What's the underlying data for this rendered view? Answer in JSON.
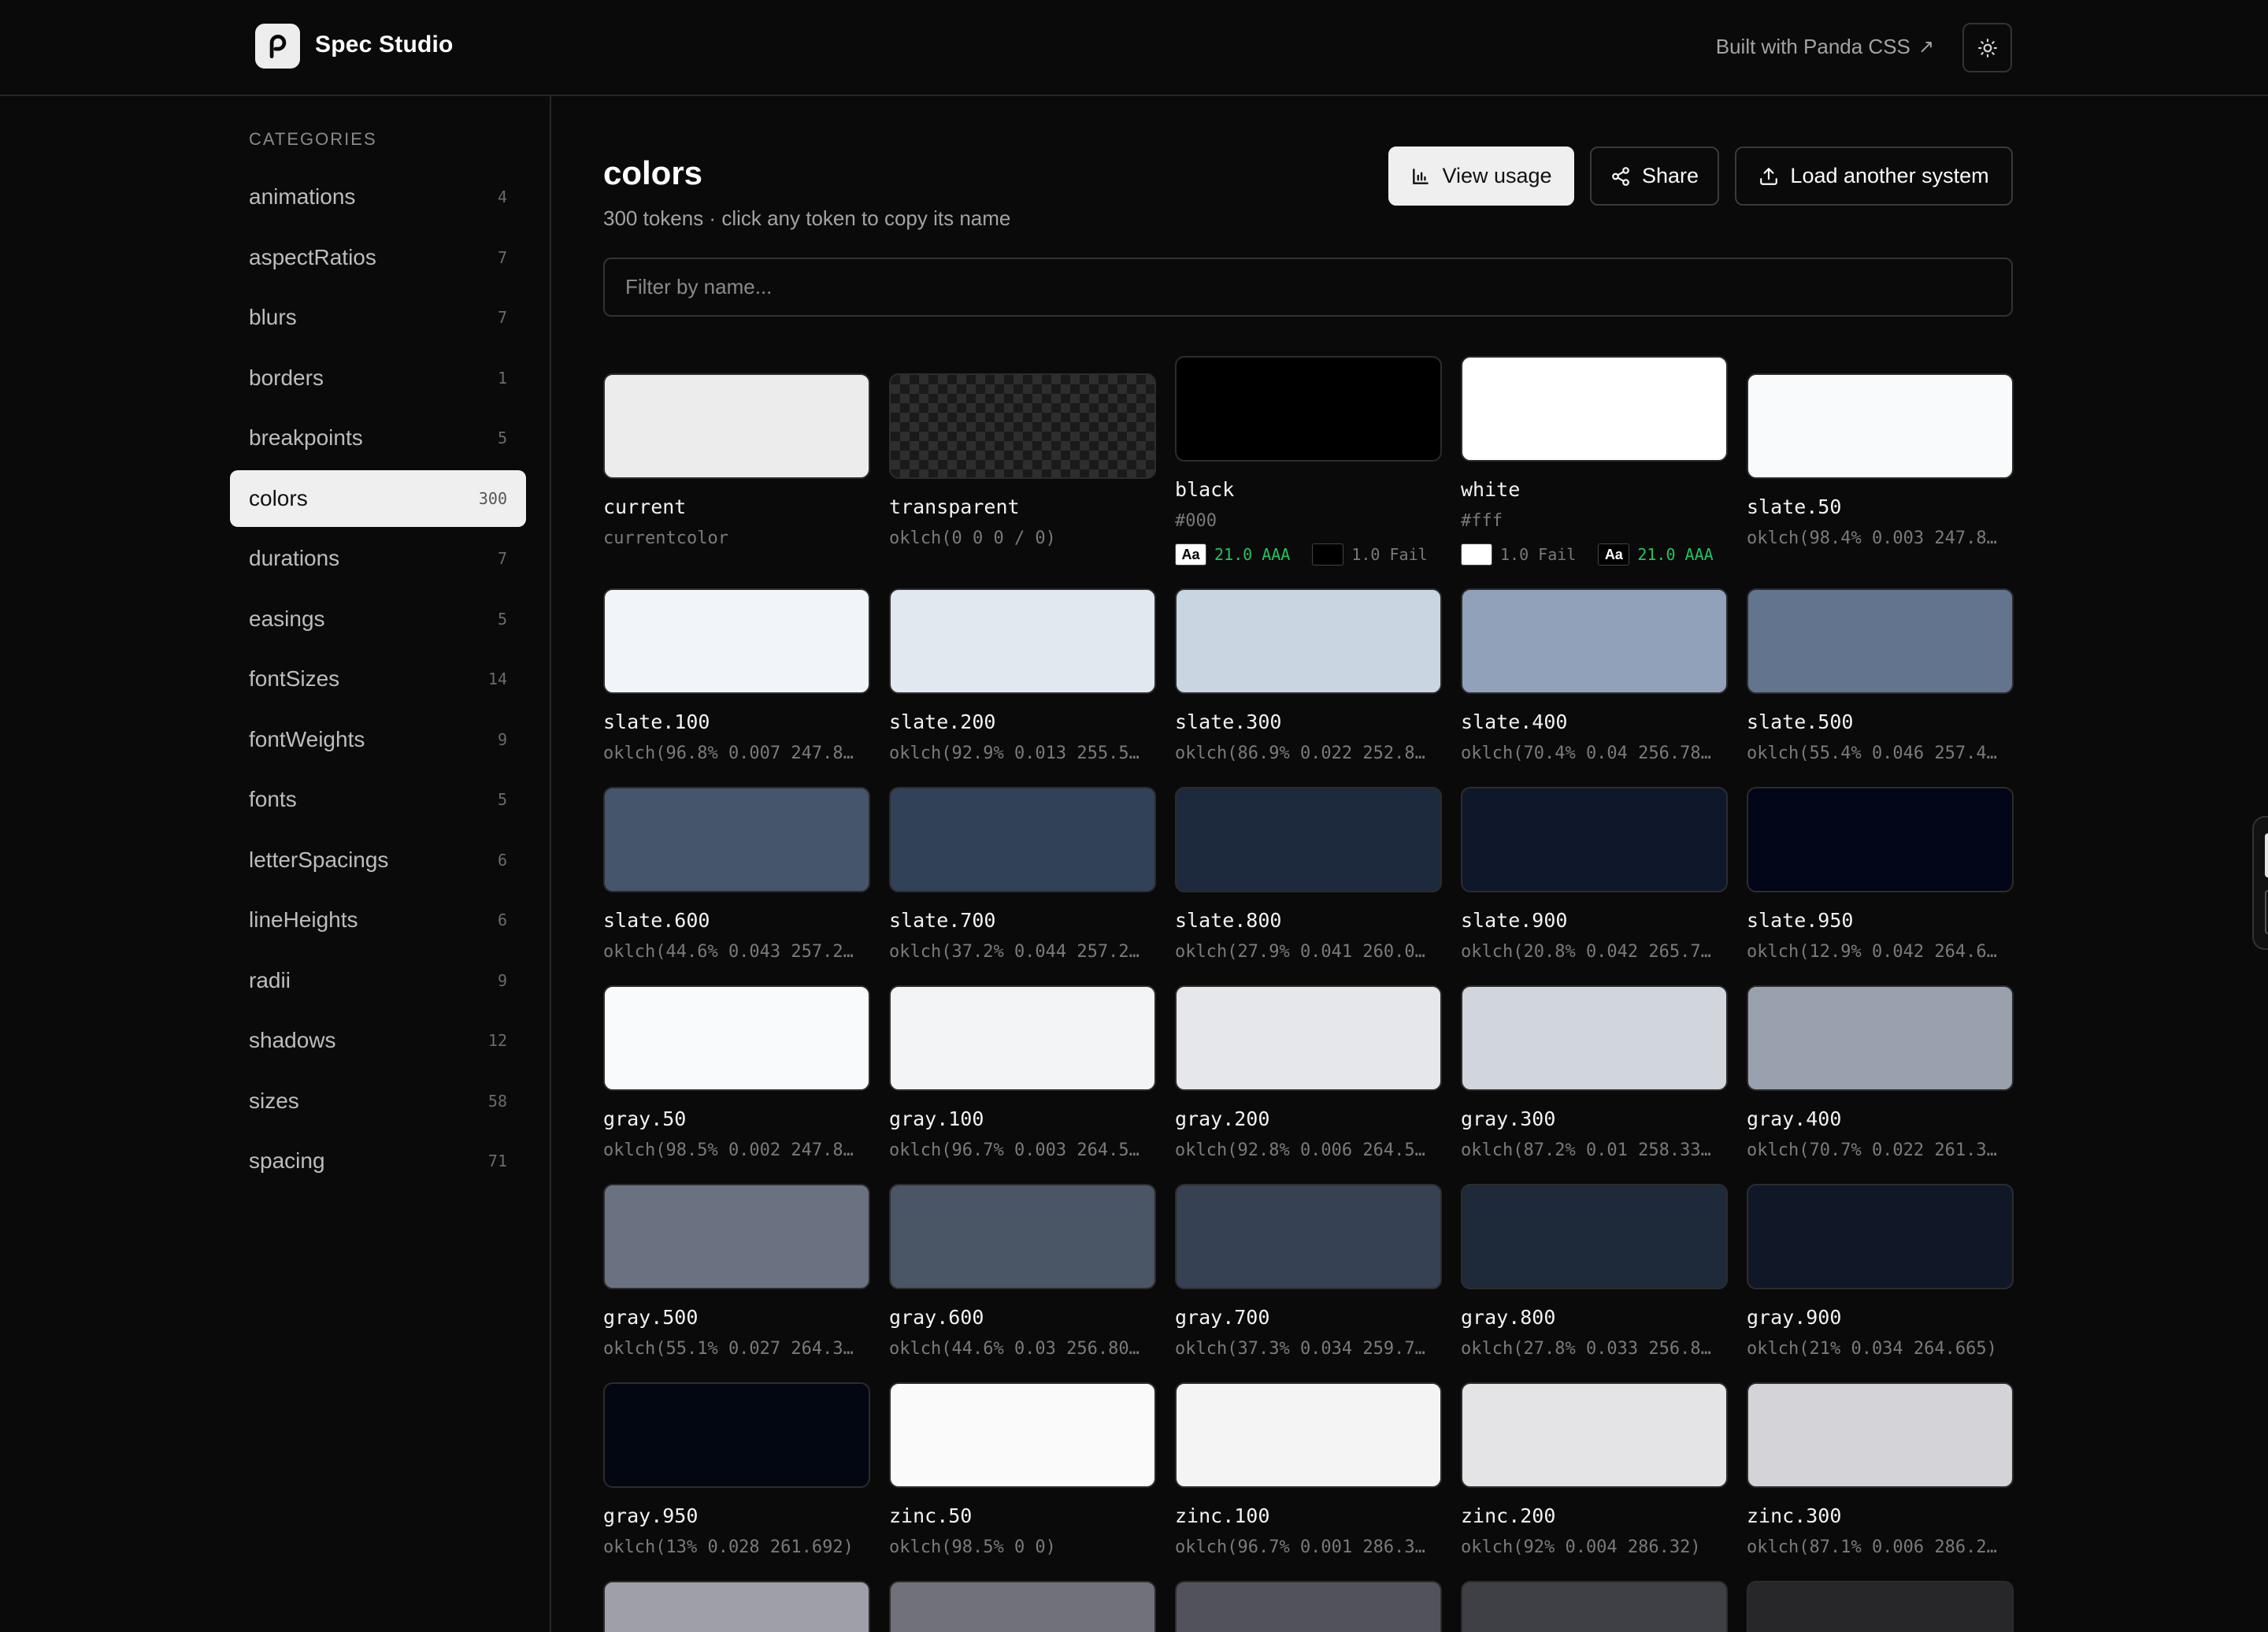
{
  "header": {
    "app_title": "Spec Studio",
    "built_with": "Built with Panda CSS",
    "built_with_icon": "external-link-icon",
    "theme_icon": "sun-icon"
  },
  "sidebar": {
    "heading": "CATEGORIES",
    "items": [
      {
        "label": "animations",
        "count": "4"
      },
      {
        "label": "aspectRatios",
        "count": "7"
      },
      {
        "label": "blurs",
        "count": "7"
      },
      {
        "label": "borders",
        "count": "1"
      },
      {
        "label": "breakpoints",
        "count": "5"
      },
      {
        "label": "colors",
        "count": "300",
        "active": true
      },
      {
        "label": "durations",
        "count": "7"
      },
      {
        "label": "easings",
        "count": "5"
      },
      {
        "label": "fontSizes",
        "count": "14"
      },
      {
        "label": "fontWeights",
        "count": "9"
      },
      {
        "label": "fonts",
        "count": "5"
      },
      {
        "label": "letterSpacings",
        "count": "6"
      },
      {
        "label": "lineHeights",
        "count": "6"
      },
      {
        "label": "radii",
        "count": "9"
      },
      {
        "label": "shadows",
        "count": "12"
      },
      {
        "label": "sizes",
        "count": "58"
      },
      {
        "label": "spacing",
        "count": "71"
      }
    ]
  },
  "main": {
    "title": "colors",
    "subtitle": "300 tokens · click any token to copy its name",
    "view_usage": "View usage",
    "share": "Share",
    "load_another": "Load another system",
    "filter_placeholder": "Filter by name..."
  },
  "tokens": [
    {
      "name": "current",
      "value": "currentcolor",
      "color": "#ececec"
    },
    {
      "name": "transparent",
      "value": "oklch(0 0 0 / 0)",
      "color": "transparent"
    },
    {
      "name": "black",
      "value": "#000",
      "color": "#000000",
      "contrast": [
        {
          "chip": "Aa",
          "chip_bg": "#ffffff",
          "chip_fg": "#000000",
          "text": "21.0 AAA",
          "status": "pass"
        },
        {
          "chip": "",
          "chip_bg": "#000000",
          "chip_fg": "#000000",
          "text": "1.0 Fail",
          "status": "fail"
        }
      ]
    },
    {
      "name": "white",
      "value": "#fff",
      "color": "#ffffff",
      "contrast": [
        {
          "chip": "",
          "chip_bg": "#ffffff",
          "chip_fg": "#ffffff",
          "text": "1.0 Fail",
          "status": "fail"
        },
        {
          "chip": "Aa",
          "chip_bg": "#000000",
          "chip_fg": "#ffffff",
          "text": "21.0 AAA",
          "status": "pass"
        }
      ]
    },
    {
      "name": "slate.50",
      "value": "oklch(98.4% 0.003 247.8…",
      "color": "#f8fafc"
    },
    {
      "name": "slate.100",
      "value": "oklch(96.8% 0.007 247.8…",
      "color": "#f1f5f9"
    },
    {
      "name": "slate.200",
      "value": "oklch(92.9% 0.013 255.5…",
      "color": "#e2e8f0"
    },
    {
      "name": "slate.300",
      "value": "oklch(86.9% 0.022 252.8…",
      "color": "#cad5e2"
    },
    {
      "name": "slate.400",
      "value": "oklch(70.4% 0.04 256.78…",
      "color": "#90a1b9"
    },
    {
      "name": "slate.500",
      "value": "oklch(55.4% 0.046 257.4…",
      "color": "#62748e"
    },
    {
      "name": "slate.600",
      "value": "oklch(44.6% 0.043 257.2…",
      "color": "#45556c"
    },
    {
      "name": "slate.700",
      "value": "oklch(37.2% 0.044 257.2…",
      "color": "#314158"
    },
    {
      "name": "slate.800",
      "value": "oklch(27.9% 0.041 260.0…",
      "color": "#1d293d"
    },
    {
      "name": "slate.900",
      "value": "oklch(20.8% 0.042 265.7…",
      "color": "#0f172b"
    },
    {
      "name": "slate.950",
      "value": "oklch(12.9% 0.042 264.6…",
      "color": "#020618"
    },
    {
      "name": "gray.50",
      "value": "oklch(98.5% 0.002 247.8…",
      "color": "#f9fafb"
    },
    {
      "name": "gray.100",
      "value": "oklch(96.7% 0.003 264.5…",
      "color": "#f3f4f6"
    },
    {
      "name": "gray.200",
      "value": "oklch(92.8% 0.006 264.5…",
      "color": "#e5e7eb"
    },
    {
      "name": "gray.300",
      "value": "oklch(87.2% 0.01 258.33…",
      "color": "#d1d5dc"
    },
    {
      "name": "gray.400",
      "value": "oklch(70.7% 0.022 261.3…",
      "color": "#99a1af"
    },
    {
      "name": "gray.500",
      "value": "oklch(55.1% 0.027 264.3…",
      "color": "#6a7282"
    },
    {
      "name": "gray.600",
      "value": "oklch(44.6% 0.03 256.80…",
      "color": "#4a5565"
    },
    {
      "name": "gray.700",
      "value": "oklch(37.3% 0.034 259.7…",
      "color": "#364153"
    },
    {
      "name": "gray.800",
      "value": "oklch(27.8% 0.033 256.8…",
      "color": "#1e2939"
    },
    {
      "name": "gray.900",
      "value": "oklch(21% 0.034 264.665)",
      "color": "#101828"
    },
    {
      "name": "gray.950",
      "value": "oklch(13% 0.028 261.692)",
      "color": "#030712"
    },
    {
      "name": "zinc.50",
      "value": "oklch(98.5% 0 0)",
      "color": "#fafafa"
    },
    {
      "name": "zinc.100",
      "value": "oklch(96.7% 0.001 286.3…",
      "color": "#f4f4f5"
    },
    {
      "name": "zinc.200",
      "value": "oklch(92% 0.004 286.32)",
      "color": "#e4e4e7"
    },
    {
      "name": "zinc.300",
      "value": "oklch(87.1% 0.006 286.2…",
      "color": "#d4d4d8"
    },
    {
      "name": "",
      "value": "",
      "color": "#9f9fa9"
    },
    {
      "name": "",
      "value": "",
      "color": "#71717b"
    },
    {
      "name": "",
      "value": "",
      "color": "#52525c"
    },
    {
      "name": "",
      "value": "",
      "color": "#3f3f46"
    },
    {
      "name": "",
      "value": "",
      "color": "#27272a"
    }
  ]
}
